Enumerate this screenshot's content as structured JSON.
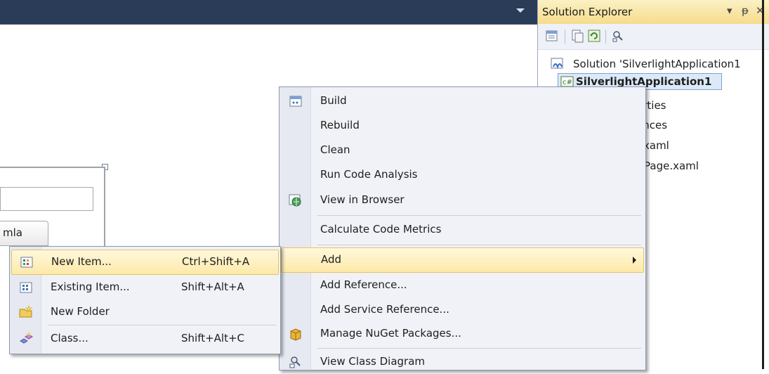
{
  "explorer": {
    "title": "Solution Explorer",
    "header_controls": {
      "dropdown": "▾",
      "pin": "ᵽ",
      "close": "✕"
    },
    "toolbar_icons": [
      "properties-icon",
      "show-all-files-icon",
      "refresh-icon",
      "view-class-diagram-icon"
    ],
    "tree": [
      {
        "label": "Solution 'SilverlightApplication1",
        "icon": "solution-icon"
      },
      {
        "label": "SilverlightApplication1",
        "icon": "csharp-project-icon",
        "selected": true
      },
      {
        "label": "erties"
      },
      {
        "label": "ences"
      },
      {
        "label": "xaml"
      },
      {
        "label": "Page.xaml"
      }
    ]
  },
  "designer": {
    "tab_label": "mla"
  },
  "context_menu": {
    "items": [
      {
        "label": "Build",
        "icon": "build-icon"
      },
      {
        "label": "Rebuild"
      },
      {
        "label": "Clean"
      },
      {
        "label": "Run Code Analysis"
      },
      {
        "label": "View in Browser",
        "icon": "browser-icon"
      },
      {
        "label": "Calculate Code Metrics"
      },
      {
        "label": "Add",
        "submenu": true,
        "highlighted": true
      },
      {
        "label": "Add Reference..."
      },
      {
        "label": "Add Service Reference..."
      },
      {
        "label": "Manage NuGet Packages...",
        "icon": "nuget-icon"
      },
      {
        "label": "View Class Diagram",
        "icon": "class-diagram-icon"
      }
    ]
  },
  "add_submenu": {
    "items": [
      {
        "label": "New Item...",
        "shortcut": "Ctrl+Shift+A",
        "icon": "new-item-icon",
        "highlighted": true
      },
      {
        "label": "Existing Item...",
        "shortcut": "Shift+Alt+A",
        "icon": "existing-item-icon"
      },
      {
        "label": "New Folder",
        "shortcut": "",
        "icon": "new-folder-icon"
      },
      {
        "label": "Class...",
        "shortcut": "Shift+Alt+C",
        "icon": "class-icon"
      }
    ]
  },
  "colors": {
    "menu_highlight": "#fde9a8",
    "header_gold": "#f6dc8c",
    "top_strip": "#2b3c59"
  }
}
